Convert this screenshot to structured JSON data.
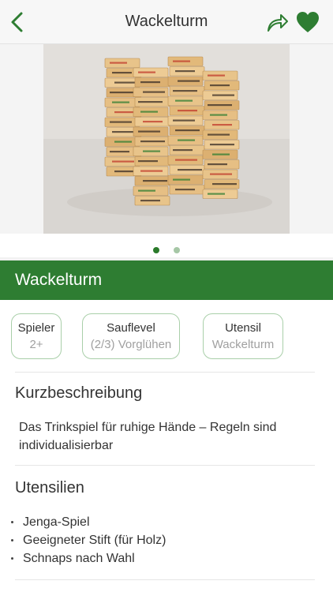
{
  "nav": {
    "title": "Wackelturm",
    "back_icon": "chevron-left-icon",
    "share_icon": "share-arrow-icon",
    "favorite_icon": "heart-icon"
  },
  "gallery": {
    "photo_description_icon": "jenga-tower-photo",
    "page_count": 2,
    "active_page": 1
  },
  "game": {
    "title": "Wackelturm"
  },
  "attributes": [
    {
      "label": "Spieler",
      "value": "2+"
    },
    {
      "label": "Sauflevel",
      "value": "(2/3) Vorglühen"
    },
    {
      "label": "Utensil",
      "value": "Wackelturm"
    }
  ],
  "short_description": {
    "heading": "Kurzbeschreibung",
    "text": "Das Trinkspiel für ruhige Hände – Regeln sind individualisierbar"
  },
  "utensils": {
    "heading": "Utensilien",
    "items": [
      "Jenga-Spiel",
      "Geeigneter Stift (für Holz)",
      "Schnaps nach Wahl"
    ]
  },
  "colors": {
    "brand_green": "#2e7d32",
    "pill_border": "#a9cfa9",
    "muted_text": "#a0a0a0"
  }
}
